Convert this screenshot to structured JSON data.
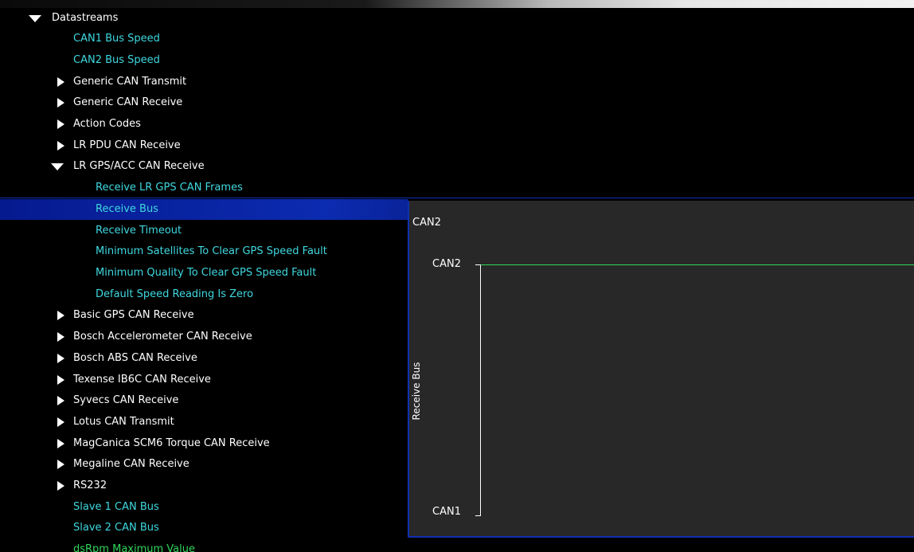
{
  "tree": {
    "root": "Datastreams",
    "items": {
      "can1_bus_speed": "CAN1 Bus Speed",
      "can2_bus_speed": "CAN2 Bus Speed",
      "generic_can_transmit": "Generic CAN Transmit",
      "generic_can_receive": "Generic CAN Receive",
      "action_codes": "Action Codes",
      "lr_pdu_can_receive": "LR PDU CAN Receive",
      "lr_gps_acc_can_receive": "LR GPS/ACC CAN Receive",
      "receive_lr_gps_can_frames": "Receive LR GPS CAN Frames",
      "receive_bus": "Receive Bus",
      "receive_timeout": "Receive Timeout",
      "min_satellites": "Minimum Satellites To Clear GPS Speed Fault",
      "min_quality": "Minimum Quality To Clear GPS Speed Fault",
      "default_speed_zero": "Default Speed Reading Is Zero",
      "basic_gps_can_receive": "Basic GPS CAN Receive",
      "bosch_accel_can_receive": "Bosch Accelerometer CAN Receive",
      "bosch_abs_can_receive": "Bosch ABS CAN Receive",
      "texense_can_receive": "Texense IB6C CAN Receive",
      "syvecs_can_receive": "Syvecs CAN Receive",
      "lotus_can_transmit": "Lotus CAN Transmit",
      "magcanica_can_receive": "MagCanica SCM6 Torque CAN Receive",
      "megaline_can_receive": "Megaline CAN Receive",
      "rs232": "RS232",
      "slave1_can_bus": "Slave 1 CAN Bus",
      "slave2_can_bus": "Slave 2 CAN Bus",
      "dsrpm_max": "dsRpm Maximum Value"
    }
  },
  "panel": {
    "value": "CAN2",
    "y_axis_label": "Receive Bus",
    "y_ticks": {
      "top": "CAN2",
      "bottom": "CAN1"
    }
  },
  "colors": {
    "folder_text": "#ffffff",
    "param_text": "#3fd8df",
    "selection": "#0b2bb0",
    "signal": "#2fd65b"
  }
}
